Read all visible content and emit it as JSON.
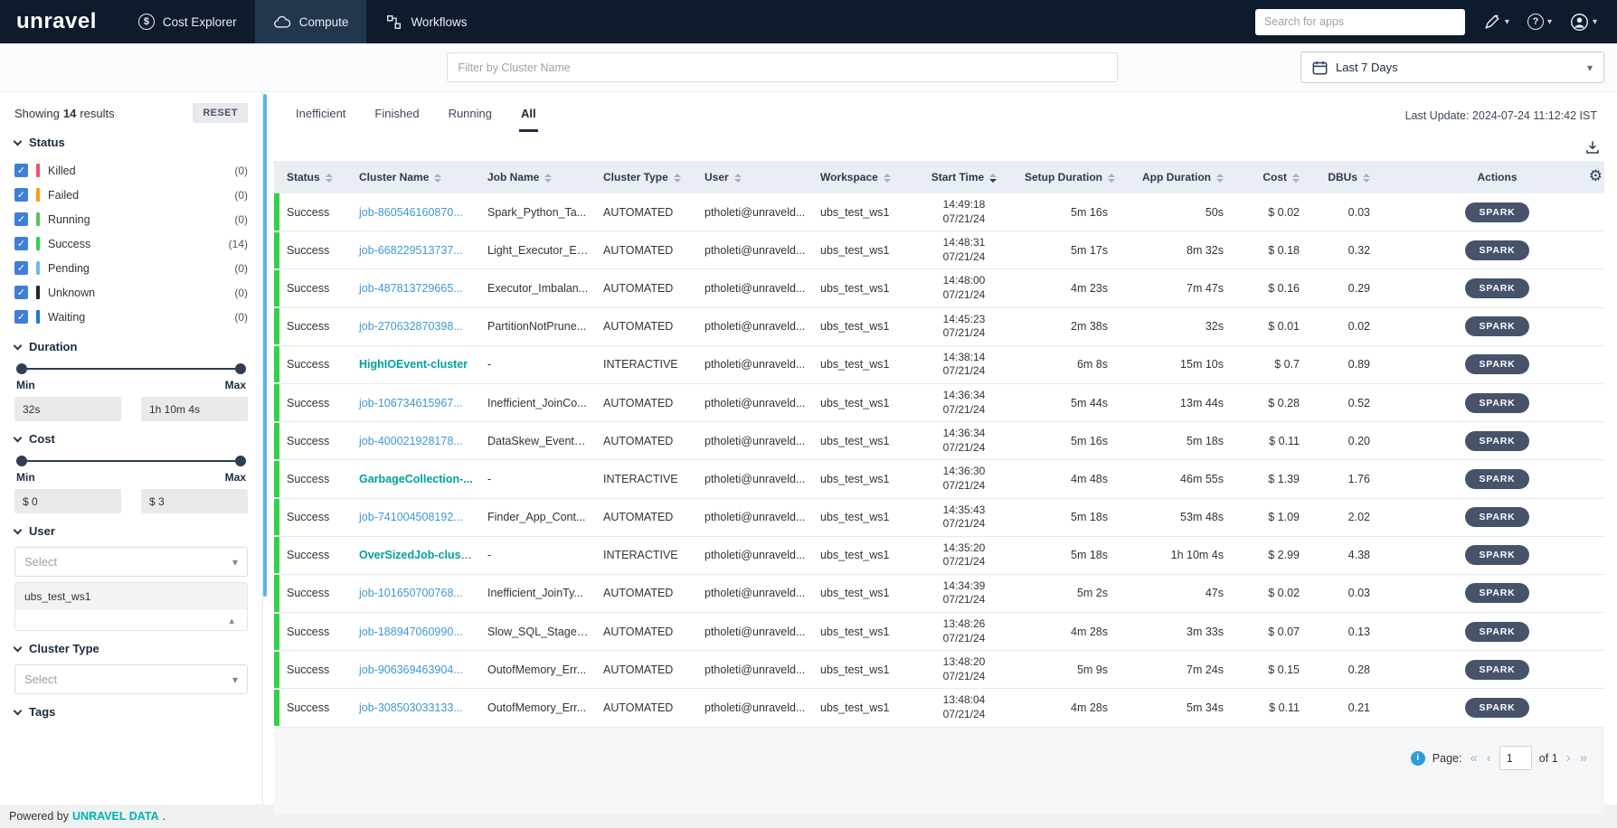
{
  "navbar": {
    "logo": "unravel",
    "items": [
      {
        "label": "Cost Explorer",
        "icon": "dollar-circle-icon",
        "active": false
      },
      {
        "label": "Compute",
        "icon": "cloud-icon",
        "active": true
      },
      {
        "label": "Workflows",
        "icon": "workflow-icon",
        "active": false
      }
    ],
    "search_placeholder": "Search for apps",
    "right_icons": [
      "ai-assistant-icon",
      "help-icon",
      "user-icon"
    ]
  },
  "filter_bar": {
    "cluster_filter_placeholder": "Filter by Cluster Name",
    "date_range_label": "Last 7 Days"
  },
  "sidebar": {
    "results_prefix": "Showing",
    "results_count": "14",
    "results_suffix": "results",
    "reset_label": "RESET",
    "status_section": {
      "title": "Status",
      "items": [
        {
          "label": "Killed",
          "count": "(0)",
          "color": "#f4516c",
          "checked": true
        },
        {
          "label": "Failed",
          "count": "(0)",
          "color": "#ff9d14",
          "checked": true
        },
        {
          "label": "Running",
          "count": "(0)",
          "color": "#57c158",
          "checked": true
        },
        {
          "label": "Success",
          "count": "(14)",
          "color": "#35d04a",
          "checked": true
        },
        {
          "label": "Pending",
          "count": "(0)",
          "color": "#6fb9f2",
          "checked": true
        },
        {
          "label": "Unknown",
          "count": "(0)",
          "color": "#20262e",
          "checked": true
        },
        {
          "label": "Waiting",
          "count": "(0)",
          "color": "#1f78d1",
          "checked": true
        }
      ]
    },
    "duration_section": {
      "title": "Duration",
      "min_label": "Min",
      "max_label": "Max",
      "min_value": "32s",
      "max_value": "1h 10m 4s"
    },
    "cost_section": {
      "title": "Cost",
      "min_label": "Min",
      "max_label": "Max",
      "min_value": "$ 0",
      "max_value": "$ 3"
    },
    "user_section": {
      "title": "User",
      "placeholder": "Select",
      "selected_value": "ubs_test_ws1"
    },
    "cluster_type_section": {
      "title": "Cluster Type",
      "placeholder": "Select"
    },
    "tags_section": {
      "title": "Tags"
    }
  },
  "footer": {
    "prefix": "Powered by",
    "link": "UNRAVEL DATA",
    "suffix": "."
  },
  "main": {
    "tabs": [
      {
        "label": "Inefficient",
        "active": false
      },
      {
        "label": "Finished",
        "active": false
      },
      {
        "label": "Running",
        "active": false
      },
      {
        "label": "All",
        "active": true
      }
    ],
    "last_update": "Last Update: 2024-07-24 11:12:42 IST",
    "table": {
      "columns": [
        "Status",
        "Cluster Name",
        "Job Name",
        "Cluster Type",
        "User",
        "Workspace",
        "Start Time",
        "Setup Duration",
        "App Duration",
        "Cost",
        "DBUs",
        "Actions"
      ],
      "sorted_column": "Start Time",
      "rows": [
        {
          "status": "Success",
          "cluster_name": "job-860546160870...",
          "link_style": "blue",
          "job_name": "Spark_Python_Ta...",
          "cluster_type": "AUTOMATED",
          "user": "ptholeti@unraveld...",
          "workspace": "ubs_test_ws1",
          "start_time": "14:49:18",
          "start_date": "07/21/24",
          "setup_duration": "5m 16s",
          "app_duration": "50s",
          "cost": "$ 0.02",
          "dbus": "0.03",
          "action": "SPARK"
        },
        {
          "status": "Success",
          "cluster_name": "job-668229513737...",
          "link_style": "blue",
          "job_name": "Light_Executor_Ev...",
          "cluster_type": "AUTOMATED",
          "user": "ptholeti@unraveld...",
          "workspace": "ubs_test_ws1",
          "start_time": "14:48:31",
          "start_date": "07/21/24",
          "setup_duration": "5m 17s",
          "app_duration": "8m 32s",
          "cost": "$ 0.18",
          "dbus": "0.32",
          "action": "SPARK"
        },
        {
          "status": "Success",
          "cluster_name": "job-487813729665...",
          "link_style": "blue",
          "job_name": "Executor_Imbalan...",
          "cluster_type": "AUTOMATED",
          "user": "ptholeti@unraveld...",
          "workspace": "ubs_test_ws1",
          "start_time": "14:48:00",
          "start_date": "07/21/24",
          "setup_duration": "4m 23s",
          "app_duration": "7m 47s",
          "cost": "$ 0.16",
          "dbus": "0.29",
          "action": "SPARK"
        },
        {
          "status": "Success",
          "cluster_name": "job-270632870398...",
          "link_style": "blue",
          "job_name": "PartitionNotPrune...",
          "cluster_type": "AUTOMATED",
          "user": "ptholeti@unraveld...",
          "workspace": "ubs_test_ws1",
          "start_time": "14:45:23",
          "start_date": "07/21/24",
          "setup_duration": "2m 38s",
          "app_duration": "32s",
          "cost": "$ 0.01",
          "dbus": "0.02",
          "action": "SPARK"
        },
        {
          "status": "Success",
          "cluster_name": "HighIOEvent-cluster",
          "link_style": "teal",
          "job_name": "-",
          "cluster_type": "INTERACTIVE",
          "user": "ptholeti@unraveld...",
          "workspace": "ubs_test_ws1",
          "start_time": "14:38:14",
          "start_date": "07/21/24",
          "setup_duration": "6m 8s",
          "app_duration": "15m 10s",
          "cost": "$ 0.7",
          "dbus": "0.89",
          "action": "SPARK"
        },
        {
          "status": "Success",
          "cluster_name": "job-106734615967...",
          "link_style": "blue",
          "job_name": "Inefficient_JoinCo...",
          "cluster_type": "AUTOMATED",
          "user": "ptholeti@unraveld...",
          "workspace": "ubs_test_ws1",
          "start_time": "14:36:34",
          "start_date": "07/21/24",
          "setup_duration": "5m 44s",
          "app_duration": "13m 44s",
          "cost": "$ 0.28",
          "dbus": "0.52",
          "action": "SPARK"
        },
        {
          "status": "Success",
          "cluster_name": "job-400021928178...",
          "link_style": "blue",
          "job_name": "DataSkew_EventG...",
          "cluster_type": "AUTOMATED",
          "user": "ptholeti@unraveld...",
          "workspace": "ubs_test_ws1",
          "start_time": "14:36:34",
          "start_date": "07/21/24",
          "setup_duration": "5m 16s",
          "app_duration": "5m 18s",
          "cost": "$ 0.11",
          "dbus": "0.20",
          "action": "SPARK"
        },
        {
          "status": "Success",
          "cluster_name": "GarbageCollection-...",
          "link_style": "teal",
          "job_name": "-",
          "cluster_type": "INTERACTIVE",
          "user": "ptholeti@unraveld...",
          "workspace": "ubs_test_ws1",
          "start_time": "14:36:30",
          "start_date": "07/21/24",
          "setup_duration": "4m 48s",
          "app_duration": "46m 55s",
          "cost": "$ 1.39",
          "dbus": "1.76",
          "action": "SPARK"
        },
        {
          "status": "Success",
          "cluster_name": "job-741004508192...",
          "link_style": "blue",
          "job_name": "Finder_App_Cont...",
          "cluster_type": "AUTOMATED",
          "user": "ptholeti@unraveld...",
          "workspace": "ubs_test_ws1",
          "start_time": "14:35:43",
          "start_date": "07/21/24",
          "setup_duration": "5m 18s",
          "app_duration": "53m 48s",
          "cost": "$ 1.09",
          "dbus": "2.02",
          "action": "SPARK"
        },
        {
          "status": "Success",
          "cluster_name": "OverSizedJob-clust...",
          "link_style": "teal",
          "job_name": "-",
          "cluster_type": "INTERACTIVE",
          "user": "ptholeti@unraveld...",
          "workspace": "ubs_test_ws1",
          "start_time": "14:35:20",
          "start_date": "07/21/24",
          "setup_duration": "5m 18s",
          "app_duration": "1h 10m 4s",
          "cost": "$ 2.99",
          "dbus": "4.38",
          "action": "SPARK"
        },
        {
          "status": "Success",
          "cluster_name": "job-101650700768...",
          "link_style": "blue",
          "job_name": "Inefficient_JoinTy...",
          "cluster_type": "AUTOMATED",
          "user": "ptholeti@unraveld...",
          "workspace": "ubs_test_ws1",
          "start_time": "14:34:39",
          "start_date": "07/21/24",
          "setup_duration": "5m 2s",
          "app_duration": "47s",
          "cost": "$ 0.02",
          "dbus": "0.03",
          "action": "SPARK"
        },
        {
          "status": "Success",
          "cluster_name": "job-188947060990...",
          "link_style": "blue",
          "job_name": "Slow_SQL_Stage_...",
          "cluster_type": "AUTOMATED",
          "user": "ptholeti@unraveld...",
          "workspace": "ubs_test_ws1",
          "start_time": "13:48:26",
          "start_date": "07/21/24",
          "setup_duration": "4m 28s",
          "app_duration": "3m 33s",
          "cost": "$ 0.07",
          "dbus": "0.13",
          "action": "SPARK"
        },
        {
          "status": "Success",
          "cluster_name": "job-906369463904...",
          "link_style": "blue",
          "job_name": "OutofMemory_Err...",
          "cluster_type": "AUTOMATED",
          "user": "ptholeti@unraveld...",
          "workspace": "ubs_test_ws1",
          "start_time": "13:48:20",
          "start_date": "07/21/24",
          "setup_duration": "5m 9s",
          "app_duration": "7m 24s",
          "cost": "$ 0.15",
          "dbus": "0.28",
          "action": "SPARK"
        },
        {
          "status": "Success",
          "cluster_name": "job-308503033133...",
          "link_style": "blue",
          "job_name": "OutofMemory_Err...",
          "cluster_type": "AUTOMATED",
          "user": "ptholeti@unraveld...",
          "workspace": "ubs_test_ws1",
          "start_time": "13:48:04",
          "start_date": "07/21/24",
          "setup_duration": "4m 28s",
          "app_duration": "5m 34s",
          "cost": "$ 0.11",
          "dbus": "0.21",
          "action": "SPARK"
        }
      ]
    },
    "pagination": {
      "label": "Page:",
      "current_page": "1",
      "total_label": "of 1"
    }
  }
}
